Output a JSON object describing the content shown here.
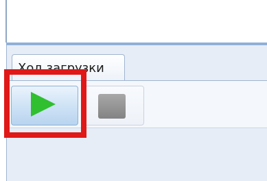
{
  "tabs": [
    {
      "label": "Ход загрузки",
      "active": true
    }
  ],
  "toolbar": {
    "play_icon": "play-icon",
    "stop_icon": "stop-icon"
  },
  "highlight": {
    "color": "#e01818",
    "target": "play-button"
  },
  "colors": {
    "divider": "#8fb0d8",
    "panel_background": "#e7edf6",
    "play_green": "#2fbf2f"
  }
}
